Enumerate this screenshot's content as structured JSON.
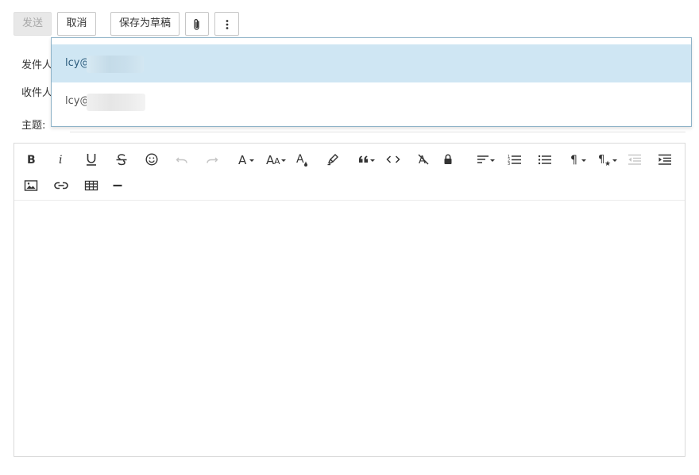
{
  "toolbar": {
    "send_label": "发送",
    "cancel_label": "取消",
    "save_draft_label": "保存为草稿"
  },
  "form": {
    "from_label": "发件人",
    "to_label": "收件人",
    "subject_label": "主题:"
  },
  "autocomplete": {
    "items": [
      {
        "text": "lcy@",
        "selected": true
      },
      {
        "text": "lcy@",
        "selected": false
      }
    ]
  },
  "editor": {
    "buttons": [
      "bold",
      "italic",
      "underline",
      "strikethrough",
      "emoji",
      "undo",
      "redo",
      "font-family",
      "font-size",
      "text-color",
      "highlight",
      "quote",
      "code",
      "clear-format",
      "lock",
      "align",
      "ordered-list",
      "unordered-list",
      "paragraph-format",
      "paragraph-style",
      "outdent",
      "indent",
      "insert-image",
      "insert-link",
      "insert-table",
      "horizontal-rule"
    ],
    "disabled_buttons": [
      "undo",
      "redo",
      "outdent"
    ]
  },
  "colors": {
    "selected_row": "#cfe6f3",
    "selected_text": "#2c5b7c",
    "dropdown_border": "#8fb3c8",
    "disabled_button_bg": "#e8e8e8"
  }
}
